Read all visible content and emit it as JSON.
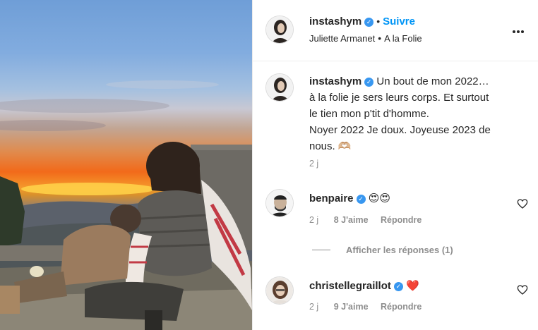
{
  "post": {
    "author": "instashym",
    "follow_label": "Suivre",
    "separator": "•",
    "audio_artist": "Juliette Armanet",
    "audio_track": "A la Folie"
  },
  "caption": {
    "author": "instashym",
    "lines": [
      "Un bout de mon 2022…",
      "à la folie je sers leurs corps. Et surtout",
      "le tien mon p'tit d'homme.",
      "Noyer 2022 Je doux. Joyeuse 2023 de",
      "nous. 🫶🏼"
    ],
    "time": "2 j"
  },
  "comments": [
    {
      "user": "benpaire",
      "text": "😍😍",
      "time": "2 j",
      "likes": "8 J'aime",
      "reply": "Répondre"
    },
    {
      "user": "christellegraillot",
      "text": "❤️",
      "time": "2 j",
      "likes": "9 J'aime",
      "reply": "Répondre"
    }
  ],
  "view_replies": "Afficher les réponses (1)",
  "colors": {
    "accent": "#0095f6",
    "verified": "#3897f0",
    "muted": "#8e8e8e",
    "text": "#262626"
  },
  "icons": [
    "verified-badge-icon",
    "more-options-icon",
    "heart-icon"
  ]
}
